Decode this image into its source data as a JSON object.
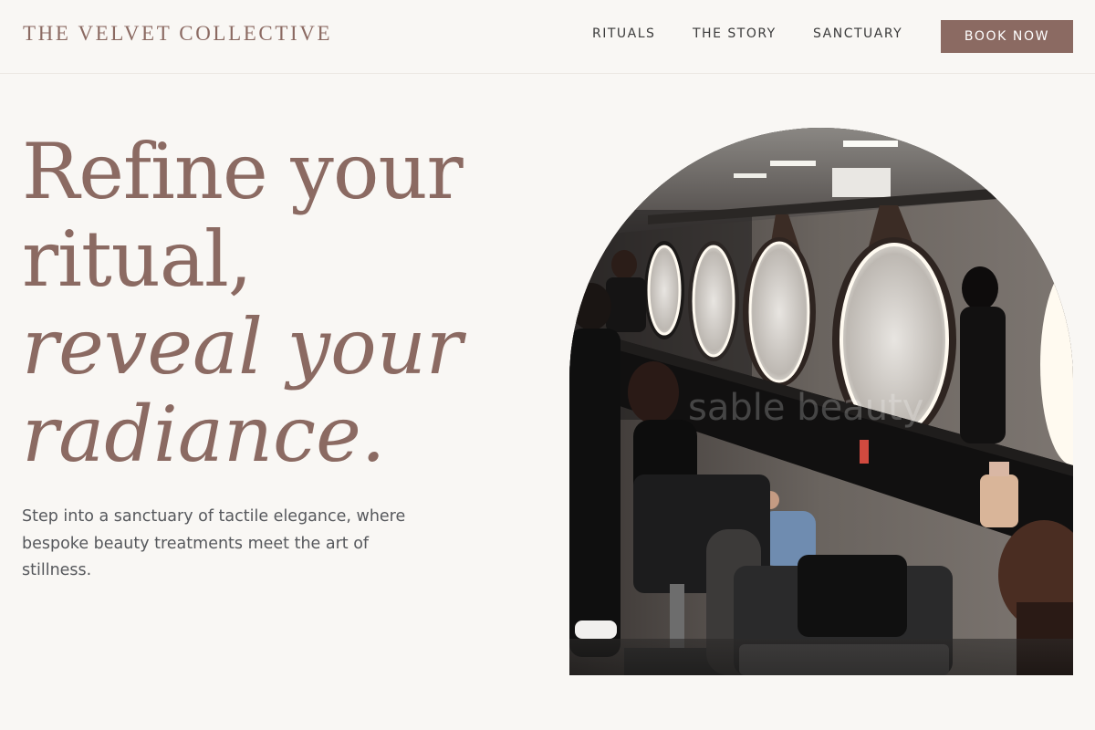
{
  "header": {
    "brand": "THE VELVET COLLECTIVE",
    "nav": [
      "RITUALS",
      "THE STORY",
      "SANCTUARY"
    ],
    "cta": "BOOK NOW"
  },
  "hero": {
    "headline": {
      "line1": "Refine your",
      "line2": "ritual,",
      "line3": "reveal your",
      "line4": "radiance."
    },
    "subtext": "Step into a sanctuary of tactile elegance, where bespoke beauty treatments meet the art of stillness.",
    "image_watermark": "sable beauty"
  },
  "colors": {
    "accent": "#8b6a62",
    "background": "#f9f7f4",
    "body_text": "#56585c"
  }
}
